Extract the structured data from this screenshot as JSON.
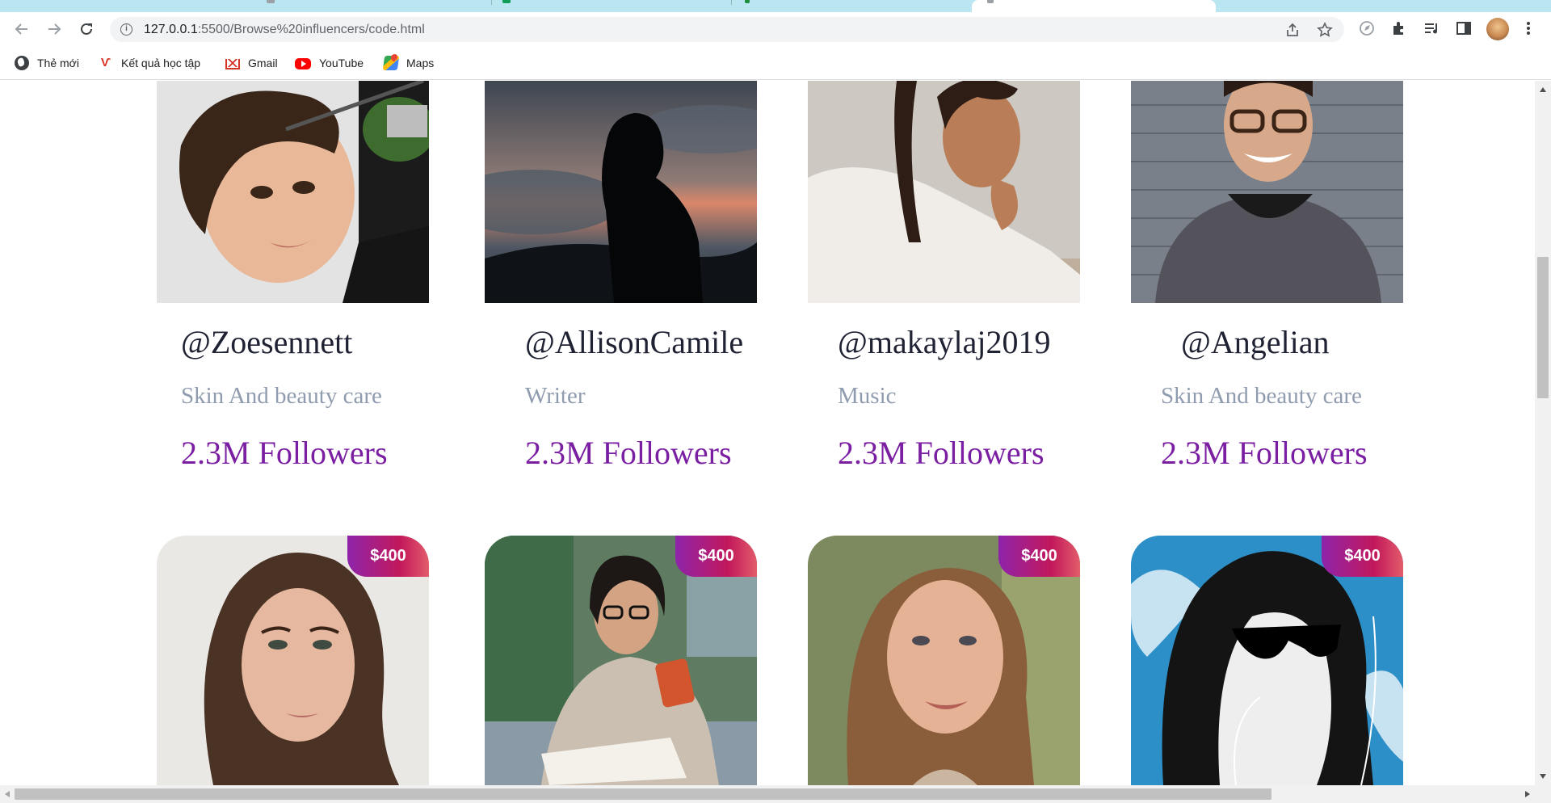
{
  "browser": {
    "url_host": "127.0.0.1",
    "url_path": ":5500/Browse%20influencers/code.html",
    "bookmarks": [
      {
        "label": "Thẻ mới",
        "icon": "globe-icon"
      },
      {
        "label": "Kết quả học tập",
        "icon": "vnu-icon"
      },
      {
        "label": "Gmail",
        "icon": "gmail-icon"
      },
      {
        "label": "YouTube",
        "icon": "youtube-icon"
      },
      {
        "label": "Maps",
        "icon": "maps-icon"
      }
    ]
  },
  "influencers": [
    {
      "handle": "@Zoesennett",
      "category": "Skin And beauty care",
      "followers": "2.3M Followers"
    },
    {
      "handle": "@AllisonCamile",
      "category": "Writer",
      "followers": "2.3M Followers"
    },
    {
      "handle": "@makaylaj2019",
      "category": "Music",
      "followers": "2.3M Followers"
    },
    {
      "handle": "@Angelian",
      "category": "Skin And beauty care",
      "followers": "2.3M Followers"
    }
  ],
  "next_row": [
    {
      "price": "$400"
    },
    {
      "price": "$400"
    },
    {
      "price": "$400"
    },
    {
      "price": "$400"
    }
  ],
  "colors": {
    "followers": "#7b1fa2",
    "category": "#8f9bae",
    "handle": "#1f2233",
    "price_gradient_start": "#8e24aa",
    "price_gradient_end": "#e35d6a"
  }
}
